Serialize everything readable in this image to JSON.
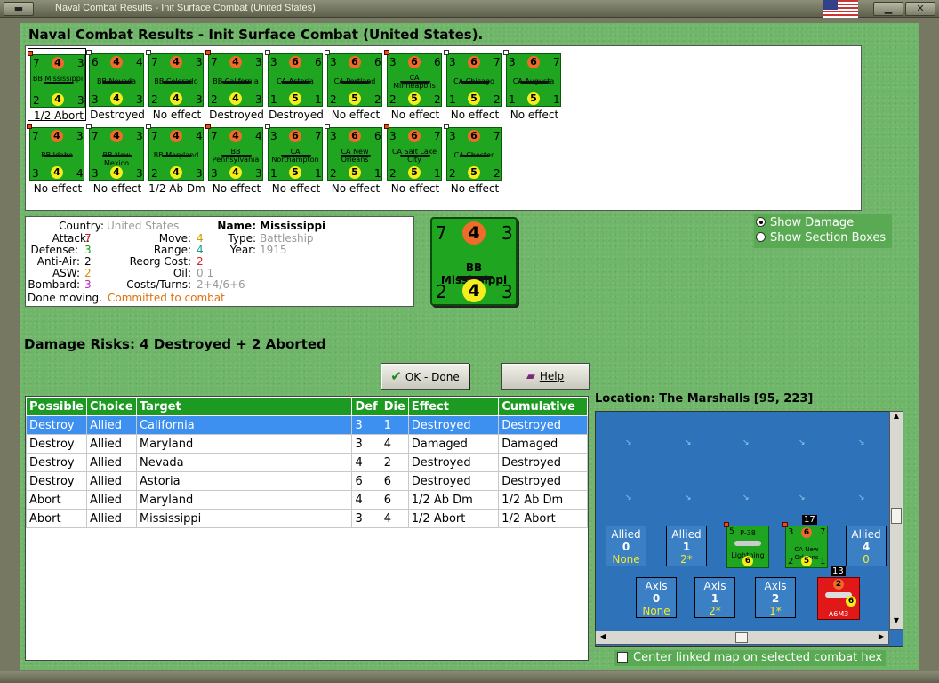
{
  "window": {
    "title": "Naval Combat Results - Init Surface Combat (United States)"
  },
  "header": {
    "heading": "Naval Combat Results - Init Surface Combat (United States)."
  },
  "units": [
    {
      "name": "BB Mississippi",
      "tl": "7",
      "tc": "4",
      "tr": "3",
      "bl": "2",
      "bc": "4",
      "br": "3",
      "result": "1/2 Abort"
    },
    {
      "name": "BB Nevada",
      "tl": "6",
      "tc": "4",
      "tr": "4",
      "bl": "3",
      "bc": "4",
      "br": "3",
      "result": "Destroyed"
    },
    {
      "name": "BB Colorado",
      "tl": "7",
      "tc": "4",
      "tr": "3",
      "bl": "2",
      "bc": "4",
      "br": "3",
      "result": "No effect"
    },
    {
      "name": "BB California",
      "tl": "7",
      "tc": "4",
      "tr": "3",
      "bl": "2",
      "bc": "4",
      "br": "3",
      "result": "Destroyed"
    },
    {
      "name": "CA Astoria",
      "tl": "3",
      "tc": "6",
      "tr": "6",
      "bl": "1",
      "bc": "5",
      "br": "1",
      "result": "Destroyed"
    },
    {
      "name": "CA Portland",
      "tl": "3",
      "tc": "6",
      "tr": "6",
      "bl": "2",
      "bc": "5",
      "br": "2",
      "result": "No effect"
    },
    {
      "name": "CA Minneapolis",
      "tl": "3",
      "tc": "6",
      "tr": "6",
      "bl": "2",
      "bc": "5",
      "br": "2",
      "result": "No effect"
    },
    {
      "name": "CA Chicago",
      "tl": "3",
      "tc": "6",
      "tr": "7",
      "bl": "1",
      "bc": "5",
      "br": "2",
      "result": "No effect"
    },
    {
      "name": "CA Augusta",
      "tl": "3",
      "tc": "6",
      "tr": "7",
      "bl": "1",
      "bc": "5",
      "br": "1",
      "result": "No effect"
    },
    {
      "name": "BB Idaho",
      "tl": "7",
      "tc": "4",
      "tr": "3",
      "bl": "3",
      "bc": "4",
      "br": "4",
      "result": "No effect"
    },
    {
      "name": "BB New Mexico",
      "tl": "7",
      "tc": "4",
      "tr": "3",
      "bl": "3",
      "bc": "4",
      "br": "3",
      "result": "No effect"
    },
    {
      "name": "BB Maryland",
      "tl": "7",
      "tc": "4",
      "tr": "4",
      "bl": "2",
      "bc": "4",
      "br": "3",
      "result": "1/2 Ab Dm"
    },
    {
      "name": "BB Pennsylvania",
      "tl": "7",
      "tc": "4",
      "tr": "4",
      "bl": "3",
      "bc": "4",
      "br": "3",
      "result": "No effect"
    },
    {
      "name": "CA Northampton",
      "tl": "3",
      "tc": "6",
      "tr": "7",
      "bl": "1",
      "bc": "5",
      "br": "1",
      "result": "No effect"
    },
    {
      "name": "CA New Orleans",
      "tl": "3",
      "tc": "6",
      "tr": "6",
      "bl": "2",
      "bc": "5",
      "br": "1",
      "result": "No effect"
    },
    {
      "name": "CA Salt Lake City",
      "tl": "3",
      "tc": "6",
      "tr": "7",
      "bl": "2",
      "bc": "5",
      "br": "1",
      "result": "No effect"
    },
    {
      "name": "CA Chester",
      "tl": "3",
      "tc": "6",
      "tr": "7",
      "bl": "2",
      "bc": "5",
      "br": "2",
      "result": "No effect"
    }
  ],
  "info": {
    "country_label": "Country:",
    "country": "United States",
    "attack_label": "Attack:",
    "attack": "7",
    "defense_label": "Defense:",
    "defense": "3",
    "antiair_label": "Anti-Air:",
    "antiair": "2",
    "asw_label": "ASW:",
    "asw": "2",
    "bombard_label": "Bombard:",
    "bombard": "3",
    "move_label": "Move:",
    "move": "4",
    "range_label": "Range:",
    "range": "4",
    "reorg_label": "Reorg Cost:",
    "reorg": "2",
    "oil_label": "Oil:",
    "oil": "0.1",
    "costs_label": "Costs/Turns:",
    "costs": "2+4/6+6",
    "name_label": "Name:",
    "name": "Mississippi",
    "type_label": "Type:",
    "type": "Battleship",
    "year_label": "Year:",
    "year": "1915",
    "status_a": "Done moving.",
    "status_b": "Committed to combat"
  },
  "big_counter": {
    "tl": "7",
    "tc": "4",
    "tr": "3",
    "name": "BB Mississippi",
    "bl": "2",
    "bc": "4",
    "br": "3"
  },
  "options": {
    "show_damage": "Show Damage",
    "show_sections": "Show Section Boxes"
  },
  "damage_risks": "Damage Risks:  4 Destroyed + 2 Aborted",
  "buttons": {
    "ok": "OK - Done",
    "help": "Help"
  },
  "table": {
    "headers": [
      "Possible",
      "Choice",
      "Target",
      "Def",
      "Die",
      "Effect",
      "Cumulative"
    ],
    "rows": [
      [
        "Destroy",
        "Allied",
        "California",
        "3",
        "1",
        "Destroyed",
        "Destroyed"
      ],
      [
        "Destroy",
        "Allied",
        "Maryland",
        "3",
        "4",
        "Damaged",
        "Damaged"
      ],
      [
        "Destroy",
        "Allied",
        "Nevada",
        "4",
        "2",
        "Destroyed",
        "Destroyed"
      ],
      [
        "Destroy",
        "Allied",
        "Astoria",
        "6",
        "6",
        "Destroyed",
        "Destroyed"
      ],
      [
        "Abort",
        "Allied",
        "Maryland",
        "4",
        "6",
        "1/2 Ab Dm",
        "1/2 Ab Dm"
      ],
      [
        "Abort",
        "Allied",
        "Mississippi",
        "3",
        "4",
        "1/2 Abort",
        "1/2 Abort"
      ]
    ]
  },
  "location": "Location:  The Marshalls [95, 223]",
  "map": {
    "allied": [
      {
        "label": "Allied",
        "n": "0",
        "s": "None"
      },
      {
        "label": "Allied",
        "n": "1",
        "s": "2*"
      },
      {
        "label": "Allied",
        "n": "4",
        "s": "0"
      }
    ],
    "axis": [
      {
        "label": "Axis",
        "n": "0",
        "s": "None"
      },
      {
        "label": "Axis",
        "n": "1",
        "s": "2*"
      },
      {
        "label": "Axis",
        "n": "2",
        "s": "1*"
      }
    ],
    "p38": {
      "tl": "5",
      "name": "P-38",
      "sub": "Lightning",
      "c": "6"
    },
    "ca_stack": {
      "count": "17",
      "tl": "3",
      "tc": "6",
      "tr": "7",
      "name": "CA New Orleans",
      "bl": "2",
      "bc": "5",
      "br": "1"
    },
    "axis_stack": {
      "count": "13",
      "tc": "2",
      "name": "A6M3",
      "c": "6"
    }
  },
  "center_link": "Center linked map on selected combat hex",
  "colors": {
    "felt": "#70b66a",
    "header_green": "#1c9a22",
    "highlight": "#3d8ff0",
    "counter_green": "#1fa51f",
    "axis_red": "#e11818"
  }
}
